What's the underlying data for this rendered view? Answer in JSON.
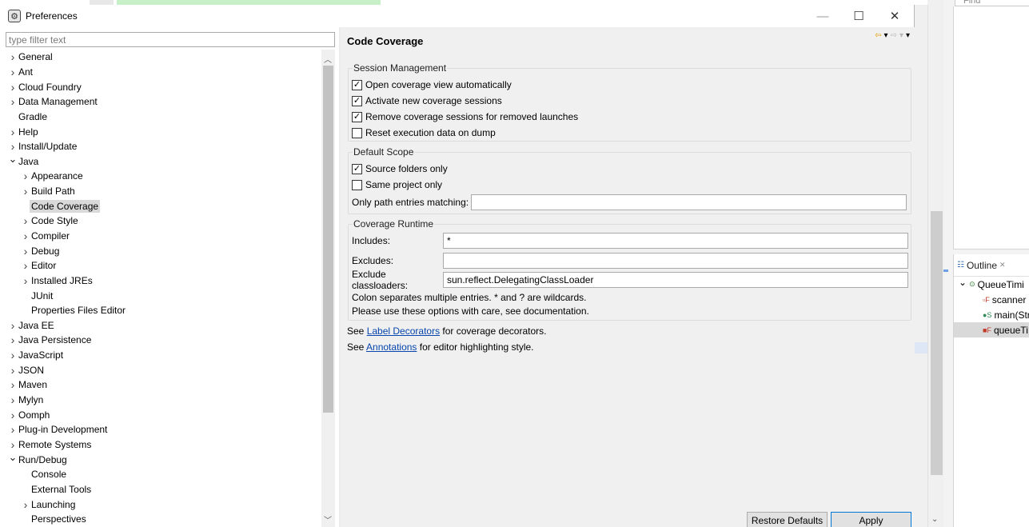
{
  "dialog": {
    "title": "Preferences",
    "window_controls": {
      "minimize": "—",
      "maximize": "☐",
      "close": "✕"
    }
  },
  "filter": {
    "placeholder": "type filter text"
  },
  "tree": {
    "items": [
      {
        "label": "General",
        "level": 0,
        "arrow": "collapsed"
      },
      {
        "label": "Ant",
        "level": 0,
        "arrow": "collapsed"
      },
      {
        "label": "Cloud Foundry",
        "level": 0,
        "arrow": "collapsed"
      },
      {
        "label": "Data Management",
        "level": 0,
        "arrow": "collapsed"
      },
      {
        "label": "Gradle",
        "level": 0,
        "arrow": "none"
      },
      {
        "label": "Help",
        "level": 0,
        "arrow": "collapsed"
      },
      {
        "label": "Install/Update",
        "level": 0,
        "arrow": "collapsed"
      },
      {
        "label": "Java",
        "level": 0,
        "arrow": "expanded"
      },
      {
        "label": "Appearance",
        "level": 1,
        "arrow": "collapsed"
      },
      {
        "label": "Build Path",
        "level": 1,
        "arrow": "collapsed"
      },
      {
        "label": "Code Coverage",
        "level": 1,
        "arrow": "none",
        "selected": true
      },
      {
        "label": "Code Style",
        "level": 1,
        "arrow": "collapsed"
      },
      {
        "label": "Compiler",
        "level": 1,
        "arrow": "collapsed"
      },
      {
        "label": "Debug",
        "level": 1,
        "arrow": "collapsed"
      },
      {
        "label": "Editor",
        "level": 1,
        "arrow": "collapsed"
      },
      {
        "label": "Installed JREs",
        "level": 1,
        "arrow": "collapsed"
      },
      {
        "label": "JUnit",
        "level": 1,
        "arrow": "none"
      },
      {
        "label": "Properties Files Editor",
        "level": 1,
        "arrow": "none"
      },
      {
        "label": "Java EE",
        "level": 0,
        "arrow": "collapsed"
      },
      {
        "label": "Java Persistence",
        "level": 0,
        "arrow": "collapsed"
      },
      {
        "label": "JavaScript",
        "level": 0,
        "arrow": "collapsed"
      },
      {
        "label": "JSON",
        "level": 0,
        "arrow": "collapsed"
      },
      {
        "label": "Maven",
        "level": 0,
        "arrow": "collapsed"
      },
      {
        "label": "Mylyn",
        "level": 0,
        "arrow": "collapsed"
      },
      {
        "label": "Oomph",
        "level": 0,
        "arrow": "collapsed"
      },
      {
        "label": "Plug-in Development",
        "level": 0,
        "arrow": "collapsed"
      },
      {
        "label": "Remote Systems",
        "level": 0,
        "arrow": "collapsed"
      },
      {
        "label": "Run/Debug",
        "level": 0,
        "arrow": "expanded"
      },
      {
        "label": "Console",
        "level": 1,
        "arrow": "none"
      },
      {
        "label": "External Tools",
        "level": 1,
        "arrow": "none"
      },
      {
        "label": "Launching",
        "level": 1,
        "arrow": "collapsed"
      },
      {
        "label": "Perspectives",
        "level": 1,
        "arrow": "none"
      }
    ]
  },
  "page": {
    "title": "Code Coverage",
    "session": {
      "label": "Session Management",
      "options": [
        {
          "label": "Open coverage view automatically",
          "checked": true
        },
        {
          "label": "Activate new coverage sessions",
          "checked": true
        },
        {
          "label": "Remove coverage sessions for removed launches",
          "checked": true
        },
        {
          "label": "Reset execution data on dump",
          "checked": false
        }
      ]
    },
    "scope": {
      "label": "Default Scope",
      "options": [
        {
          "label": "Source folders only",
          "checked": true
        },
        {
          "label": "Same project only",
          "checked": false
        }
      ],
      "path_label": "Only path entries matching:",
      "path_value": ""
    },
    "runtime": {
      "label": "Coverage Runtime",
      "includes_label": "Includes:",
      "includes_value": "*",
      "excludes_label": "Excludes:",
      "excludes_value": "",
      "classloaders_label": "Exclude classloaders:",
      "classloaders_value": "sun.reflect.DelegatingClassLoader",
      "note1": "Colon separates multiple entries. * and ? are wildcards.",
      "note2": "Please use these options with care, see documentation."
    },
    "links": {
      "see1": "See ",
      "link1": "Label Decorators",
      "rest1": " for coverage decorators.",
      "see2": "See ",
      "link2": "Annotations",
      "rest2": " for editor highlighting style."
    },
    "buttons": {
      "restore": "Restore Defaults",
      "apply": "Apply"
    }
  },
  "background": {
    "find_placeholder": "Find",
    "outline": {
      "tab_label": "Outline",
      "items": [
        {
          "label": "QueueTimi",
          "marker": "⊙",
          "color": "#2e7d32"
        },
        {
          "label": "scanner",
          "marker": "▫F",
          "color": "#c0392b"
        },
        {
          "label": "main(Str",
          "marker": "●S",
          "color": "#2e8b57"
        },
        {
          "label": "queueTi",
          "marker": "■F",
          "color": "#c0392b"
        }
      ]
    }
  }
}
